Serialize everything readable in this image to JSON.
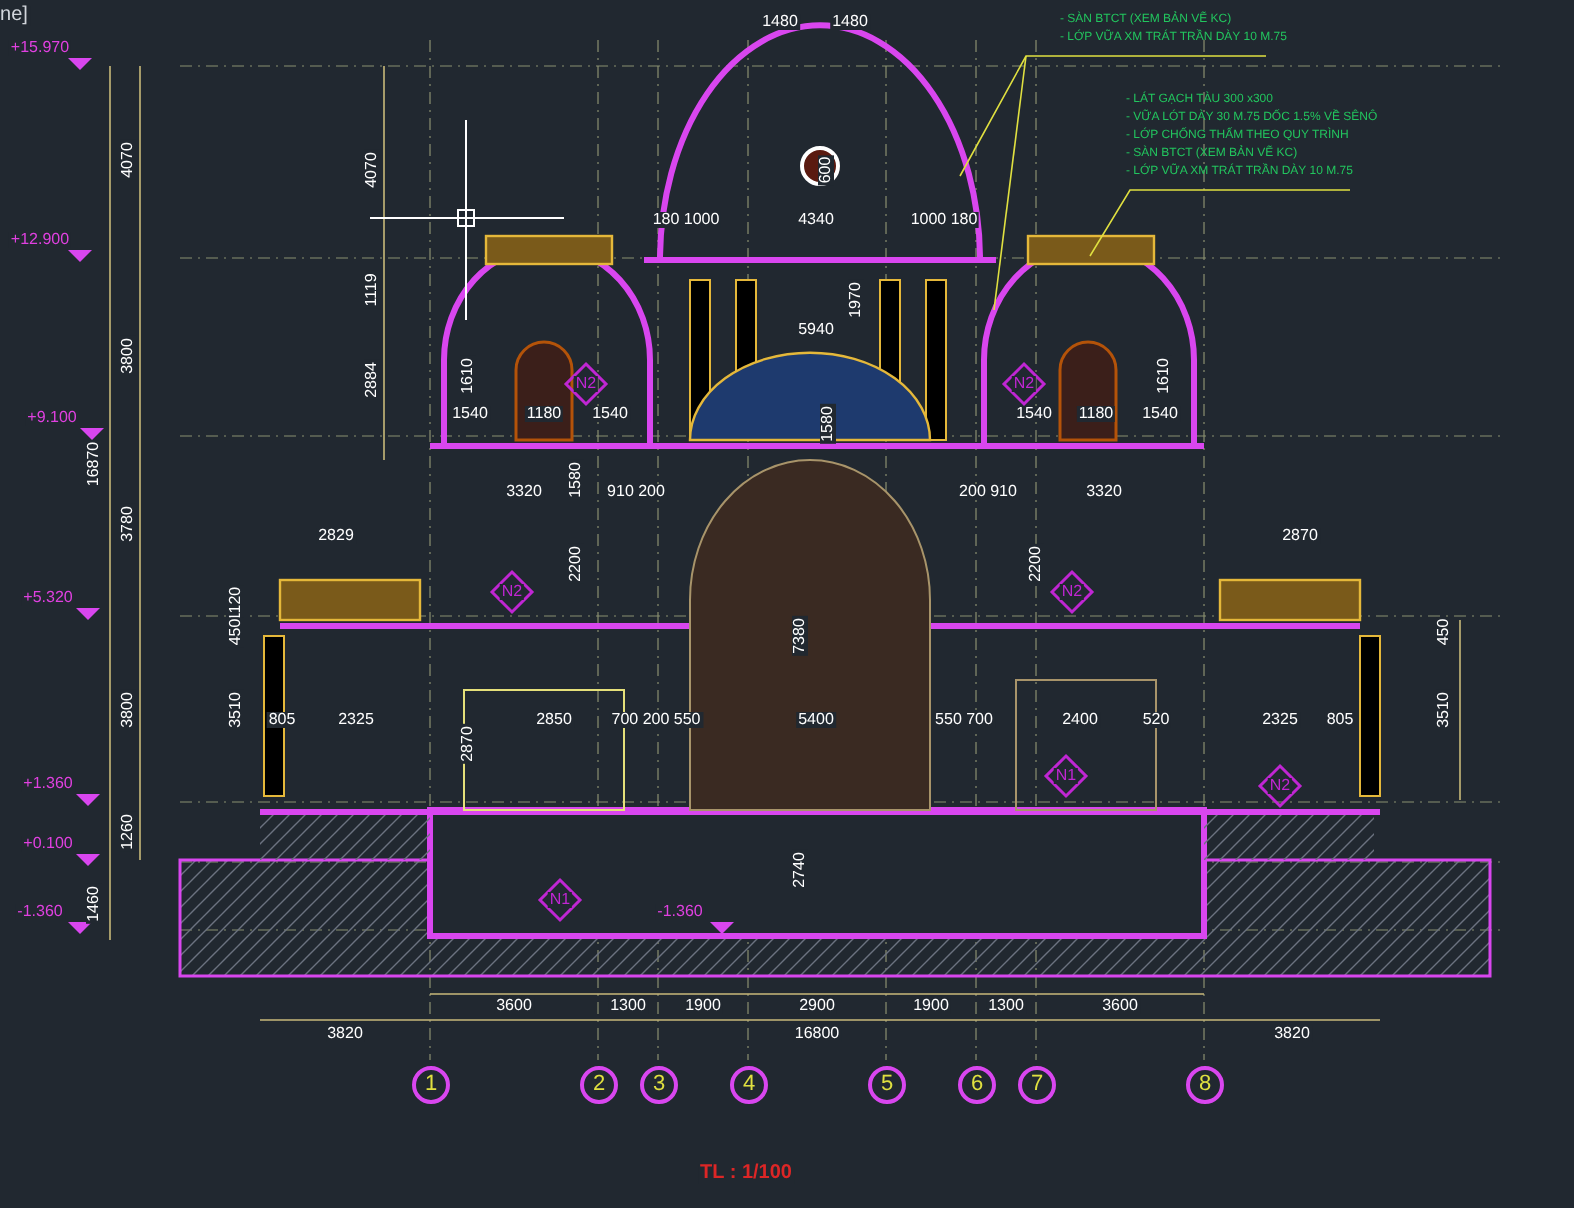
{
  "viewport_label": "ne]",
  "level_markers": [
    "+15.970",
    "+12.900",
    "+9.100",
    "+5.320",
    "+1.360",
    "+0.100",
    "-1.360",
    "-1.360"
  ],
  "vertical_dimensions": [
    "4070",
    "3800",
    "3780",
    "3800",
    "1260",
    "1460",
    "16870",
    "4070",
    "1119",
    "2884",
    "600",
    "1970",
    "1580",
    "2200",
    "2200",
    "7380",
    "2740",
    "3510",
    "3510",
    "1580",
    "1610",
    "1610",
    "1120",
    "450",
    "450",
    "2870"
  ],
  "horizontal_dimensions": [
    "1480",
    "1480",
    "180 1000",
    "4340",
    "1000 180",
    "5940",
    "1540",
    "1180",
    "1540",
    "1540",
    "1180",
    "1540",
    "3320",
    "910 200",
    "200 910",
    "3320",
    "2829",
    "2870",
    "805",
    "2325",
    "2850",
    "700 200 550",
    "5400",
    "550 700",
    "2400",
    "520",
    "2325",
    "805"
  ],
  "notes": [
    {
      "lines": [
        "- SÀN BTCT (XEM BẢN VẼ KC)",
        "- LỚP VỮA XM TRÁT TRẦN DÀY 10 M.75"
      ]
    },
    {
      "lines": [
        "- LÁT GẠCH TÀU 300 x300",
        "- VỮA LÓT DÀY 30 M.75 DỐC 1.5% VỀ SÊNÔ",
        "- LỚP CHỐNG THẤM THEO QUY TRÌNH",
        "- SÀN BTCT (XEM BẢN VẼ KC)",
        "- LỚP VỮA XM TRÁT TRẦN DÀY 10 M.75"
      ]
    }
  ],
  "tags": [
    "N2",
    "N2",
    "N2",
    "N2",
    "N1",
    "N2",
    "N1"
  ],
  "bottom_dimensions": {
    "spans": [
      "3600",
      "1300",
      "1900",
      "2900",
      "1900",
      "1300",
      "3600"
    ],
    "totals": [
      "3820",
      "16800",
      "3820"
    ]
  },
  "grid_axes": [
    "1",
    "2",
    "3",
    "4",
    "5",
    "6",
    "7",
    "8"
  ],
  "scale": "TL : 1/100"
}
